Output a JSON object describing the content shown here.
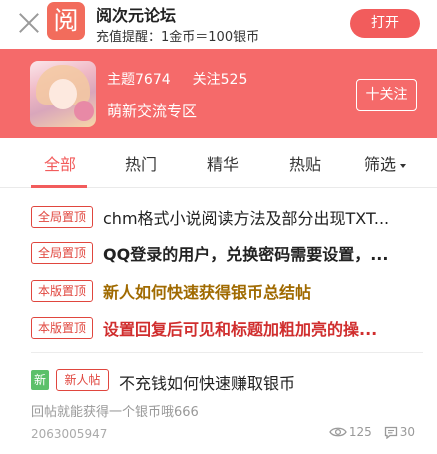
{
  "banner": {
    "logo_char": "阅",
    "app_name": "阅次元论坛",
    "subtitle": "充值提醒：1金币＝100银币",
    "open_label": "打开"
  },
  "forum": {
    "topics": "主题7674",
    "follows": "关注525",
    "name": "萌新交流专区",
    "follow_label": "十关注"
  },
  "tabs": [
    {
      "label": "全部",
      "active": true
    },
    {
      "label": "热门"
    },
    {
      "label": "精华"
    },
    {
      "label": "热贴"
    },
    {
      "label": "筛选"
    }
  ],
  "pinned": [
    {
      "tag": "全局置顶",
      "title": "chm格式小说阅读方法及部分出现TXT..."
    },
    {
      "tag": "全局置顶",
      "title": "QQ登录的用户，兑换密码需要设置，..."
    },
    {
      "tag": "本版置顶",
      "title": "新人如何快速获得银币总结帖"
    },
    {
      "tag": "本版置顶",
      "title": "设置回复后可见和标题加粗加亮的操..."
    }
  ],
  "post": {
    "badge_new": "新",
    "badge_newbie": "新人帖",
    "title": "不充钱如何快速赚取银币",
    "excerpt": "回帖就能获得一个银币哦666",
    "author": "2063005947",
    "views": "125",
    "replies": "30"
  },
  "colors": {
    "accent": "#f25c5c",
    "header_bg": "#f56a6a",
    "pin_tag": "#e0463e",
    "gold_title": "#a06a00",
    "new_badge": "#5cc06a"
  }
}
